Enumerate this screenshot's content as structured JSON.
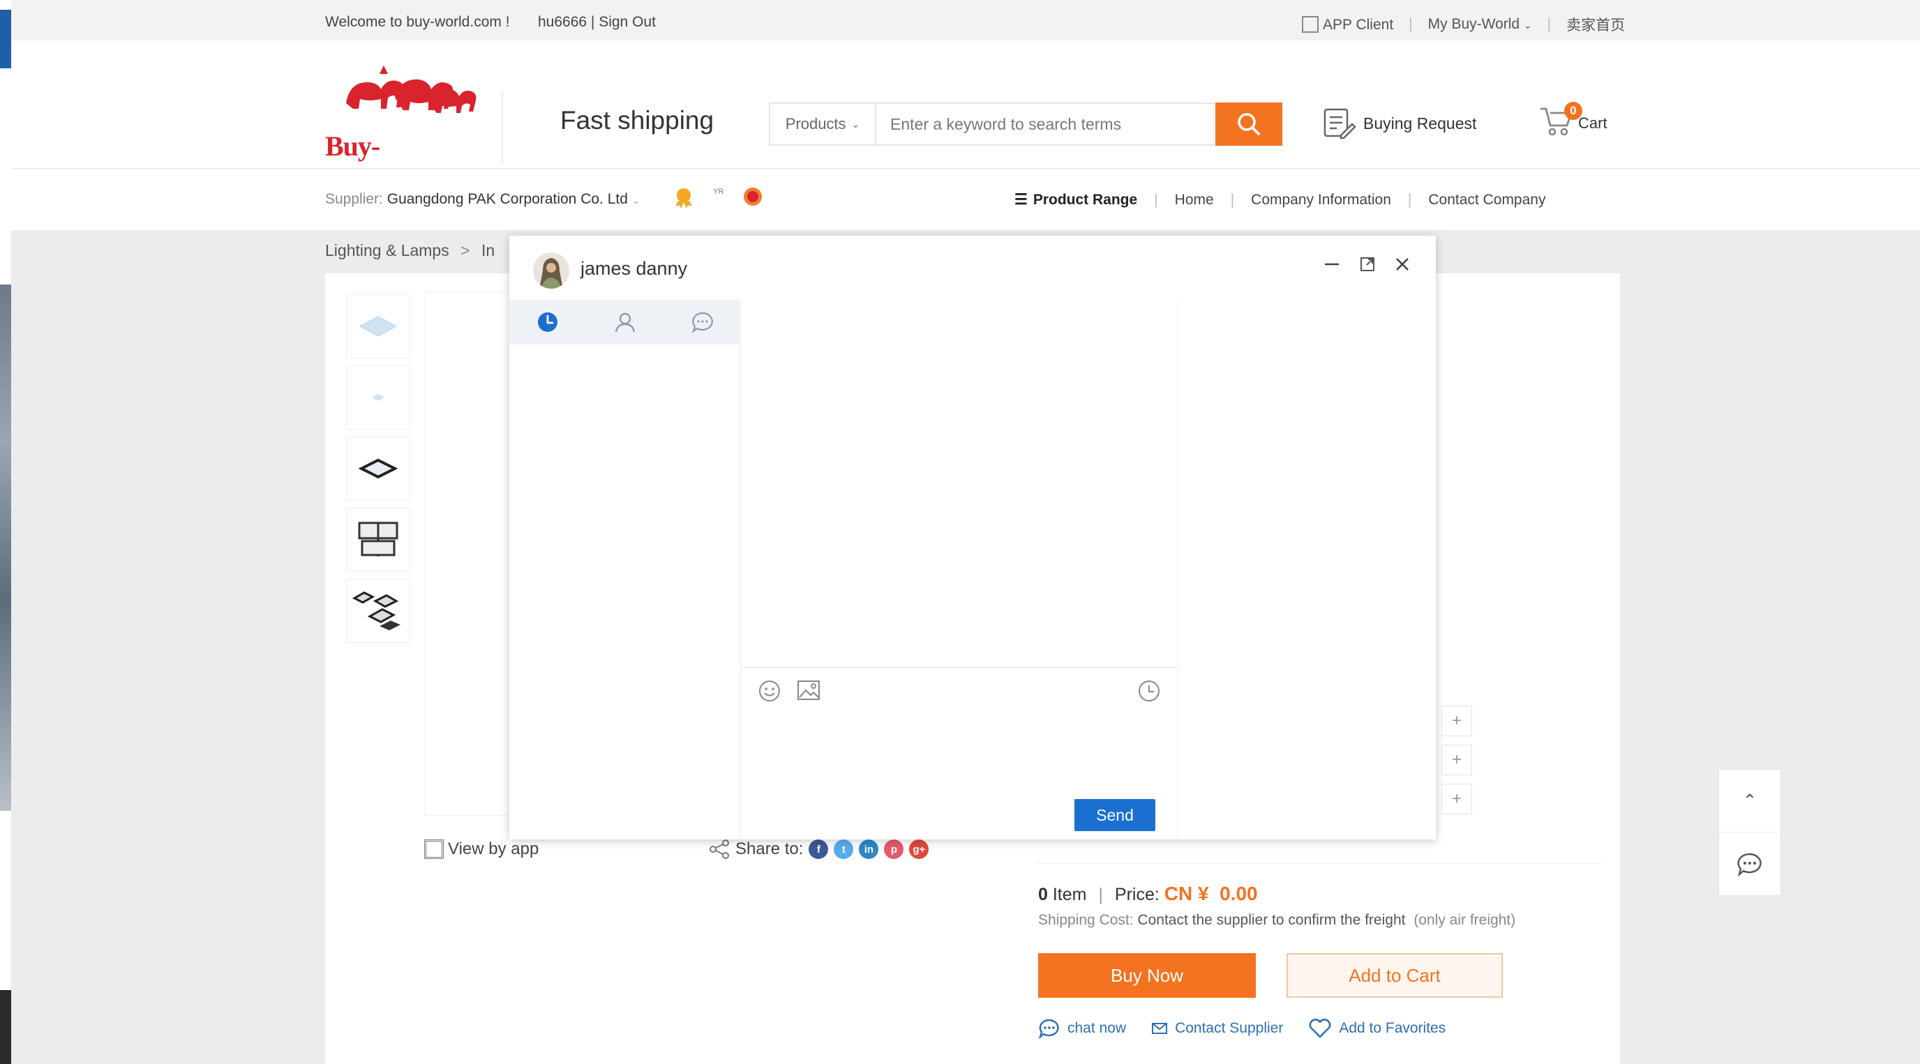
{
  "topbar": {
    "welcome": "Welcome to buy-world.com !",
    "user": "hu6666 | Sign Out",
    "app_client": "APP Client",
    "my_buy_world": "My Buy-World",
    "seller_home": "卖家首页"
  },
  "header": {
    "logo_text": "Buy-World.com",
    "slogan": "Fast shipping",
    "search_category": "Products",
    "search_placeholder": "Enter a keyword to search terms",
    "buying_request": "Buying Request",
    "cart_label": "Cart",
    "cart_count": "0"
  },
  "supplier_bar": {
    "supplier_label": "Supplier:",
    "supplier_name": "Guangdong PAK Corporation Co. Ltd",
    "badge_label": "YR",
    "nav": {
      "product_range": "Product Range",
      "home": "Home",
      "company_information": "Company Information",
      "contact_company": "Contact Company"
    }
  },
  "breadcrumb": {
    "item1": "Lighting & Lamps",
    "separator": ">",
    "item2": "In"
  },
  "product": {
    "view_by_app": "View by app",
    "share_to": "Share to:",
    "social": [
      "f",
      "t",
      "in",
      "p",
      "g+"
    ],
    "quantity": "0",
    "item_label": "Item",
    "price_label": "Price:",
    "price": "CN ¥  0.00",
    "shipping_label": "Shipping Cost:",
    "shipping_text": "Contact the supplier to confirm the freight",
    "shipping_note": "(only air freight)",
    "buy_now": "Buy Now",
    "add_to_cart": "Add to Cart",
    "chat_now": "chat now",
    "contact_supplier": "Contact Supplier",
    "add_to_favorites": "Add to Favorites"
  },
  "chat_dialog": {
    "contact_name": "james danny",
    "send_label": "Send"
  },
  "colors": {
    "accent_orange": "#f37320",
    "brand_red": "#d9232d",
    "send_blue": "#1b6fd1",
    "link_blue": "#2c6fb7"
  }
}
